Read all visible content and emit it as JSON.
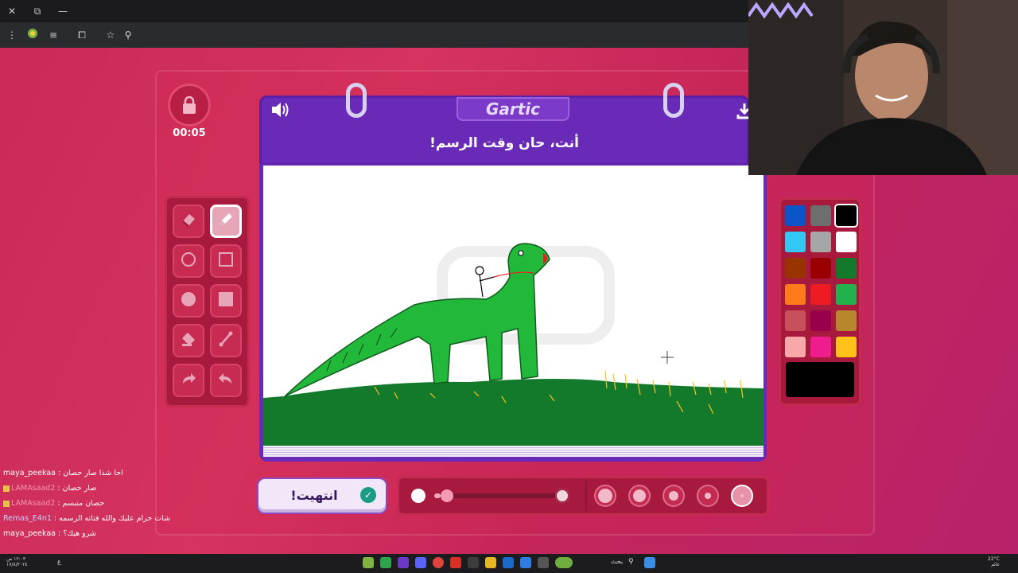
{
  "browser": {
    "close_glyph": "✕",
    "restore_glyph": "⧉",
    "minimize_glyph": "—",
    "toolbar_icons": [
      "menu-icon",
      "extension-icon",
      "translate-icon",
      "puzzle-icon",
      "star-icon",
      "search-icon"
    ]
  },
  "game": {
    "timer": "00:05",
    "logo": "Gartic",
    "prompt": "أنت، حان وقت الرسم!",
    "done_label": "انتهيت!",
    "tools": [
      {
        "name": "eraser",
        "icon": "eraser-icon",
        "active": false
      },
      {
        "name": "pencil",
        "icon": "pencil-icon",
        "active": true
      },
      {
        "name": "circle-outline",
        "icon": "circle-outline-icon",
        "active": false
      },
      {
        "name": "square-outline",
        "icon": "square-outline-icon",
        "active": false
      },
      {
        "name": "circle-filled",
        "icon": "circle-filled-icon",
        "active": false
      },
      {
        "name": "square-filled",
        "icon": "square-filled-icon",
        "active": false
      },
      {
        "name": "fill-bucket",
        "icon": "fill-bucket-icon",
        "active": false
      },
      {
        "name": "line",
        "icon": "line-icon",
        "active": false
      },
      {
        "name": "redo",
        "icon": "redo-icon",
        "active": false
      },
      {
        "name": "undo",
        "icon": "undo-icon",
        "active": false
      }
    ],
    "palette": [
      "#0b55c9",
      "#6e6e6e",
      "#000000",
      "#33c8f3",
      "#a6a6a6",
      "#ffffff",
      "#993300",
      "#9b0000",
      "#137a2b",
      "#ff7a1a",
      "#ed1c24",
      "#22b14c",
      "#c8505a",
      "#99004c",
      "#b8862c",
      "#f8a8a8",
      "#ee1c8c",
      "#ffc21a"
    ],
    "selected_color": "#000000",
    "brush_size": 0.05,
    "size_options_selected": 4
  },
  "chat": [
    {
      "user": "maya_peekaa",
      "sep": " : ",
      "message": "احا شذا صار حصان"
    },
    {
      "user": "LAMAsaad2",
      "sep": " : ",
      "message": "صار حصان"
    },
    {
      "user": "LAMAsaad2",
      "sep": " : ",
      "message": "حصان متبسم"
    },
    {
      "user": "Remas_E4n1",
      "sep": " : ",
      "message": "شات حرام عليك والله فتاته الرسمه"
    },
    {
      "user": "maya_peekaa",
      "sep": " : ",
      "message": "شرو هيك؟"
    }
  ],
  "taskbar": {
    "search_label": "بحث",
    "weather": "22°C",
    "weather_desc": "غائم",
    "clock_time": "١٢:٠٣ ص",
    "clock_date": "١٧/٨/٢٠٢٤",
    "lang": "ع"
  }
}
